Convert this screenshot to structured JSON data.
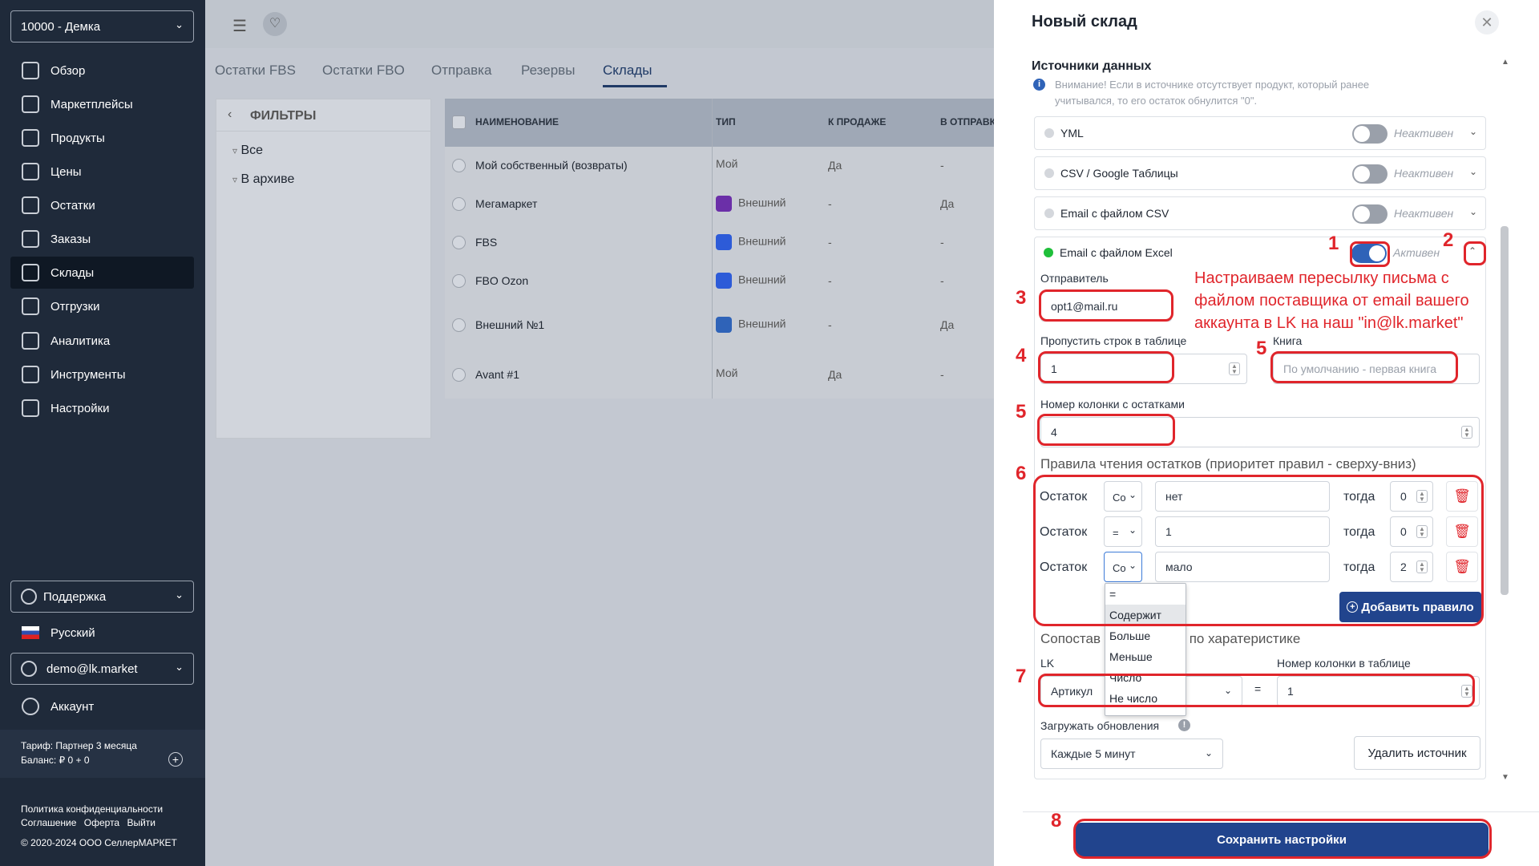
{
  "sidebar": {
    "org": "10000 - Демка",
    "items": [
      {
        "label": "Обзор",
        "icon": "overview-icon"
      },
      {
        "label": "Маркетплейсы",
        "icon": "marketplace-icon"
      },
      {
        "label": "Продукты",
        "icon": "products-icon"
      },
      {
        "label": "Цены",
        "icon": "prices-icon"
      },
      {
        "label": "Остатки",
        "icon": "stock-icon"
      },
      {
        "label": "Заказы",
        "icon": "orders-icon"
      },
      {
        "label": "Склады",
        "icon": "warehouse-icon"
      },
      {
        "label": "Отгрузки",
        "icon": "shipments-icon"
      },
      {
        "label": "Аналитика",
        "icon": "analytics-icon"
      },
      {
        "label": "Инструменты",
        "icon": "tools-icon"
      },
      {
        "label": "Настройки",
        "icon": "settings-icon"
      }
    ],
    "support": "Поддержка",
    "language": "Русский",
    "user": "demo@lk.market",
    "account": "Аккаунт",
    "tariff": "Тариф: Партнер 3 месяца",
    "balance": "Баланс: ₽ 0 + 0",
    "links": [
      "Политика конфиденциальности",
      "Соглашение",
      "Оферта",
      "Выйти"
    ],
    "copyright": "© 2020-2024 ООО СеллерМАРКЕТ"
  },
  "tabs": [
    "Остатки FBS",
    "Остатки FBO",
    "Отправка",
    "Резервы",
    "Склады"
  ],
  "filters": {
    "title": "ФИЛЬТРЫ",
    "items": [
      "Все",
      "В архиве"
    ]
  },
  "table": {
    "headers": [
      "НАИМЕНОВАНИЕ",
      "ТИП",
      "К ПРОДАЖЕ",
      "В ОТПРАВК"
    ],
    "rows": [
      {
        "name": "Мой собственный (возвраты)",
        "type": "Мой",
        "sale": "Да",
        "ship": "-"
      },
      {
        "name": "Мегамаркет",
        "type": "Внешний",
        "sale": "-",
        "ship": "Да"
      },
      {
        "name": "FBS",
        "type": "Внешний",
        "sale": "-",
        "ship": "-"
      },
      {
        "name": "FBO Ozon",
        "type": "Внешний",
        "sale": "-",
        "ship": "-"
      },
      {
        "name": "Внешний №1",
        "type": "Внешний",
        "sale": "-",
        "ship": "Да"
      },
      {
        "name": "Avant #1",
        "type": "Мой",
        "sale": "Да",
        "ship": "-"
      }
    ]
  },
  "modal": {
    "title": "Новый склад",
    "section": "Источники данных",
    "warning": "Внимание! Если в источнике отсутствует продукт, который ранее учитывался, то его остаток обнулится \"0\".",
    "sources": [
      {
        "name": "YML",
        "status": "Неактивен"
      },
      {
        "name": "CSV / Google Таблицы",
        "status": "Неактивен"
      },
      {
        "name": "Email с файлом CSV",
        "status": "Неактивен"
      },
      {
        "name": "Email с файлом Excel",
        "status": "Активен"
      }
    ],
    "sender_label": "Отправитель",
    "sender_value": "opt1@mail.ru",
    "skip_label": "Пропустить строк в таблице",
    "skip_value": "1",
    "book_label": "Книга",
    "book_placeholder": "По умолчанию - первая книга",
    "col_label": "Номер колонки с остатками",
    "col_value": "4",
    "rules_title": "Правила чтения остатков (приоритет правил - сверху-вниз)",
    "rules": [
      {
        "label": "Остаток",
        "op": "Co",
        "value": "нет",
        "then": "тогда",
        "result": "0"
      },
      {
        "label": "Остаток",
        "op": "=",
        "value": "1",
        "then": "тогда",
        "result": "0"
      },
      {
        "label": "Остаток",
        "op": "Co",
        "value": "мало",
        "then": "тогда",
        "result": "2"
      }
    ],
    "dropdown_options": [
      "=",
      "Содержит",
      "Больше",
      "Меньше",
      "Число",
      "Не число"
    ],
    "add_rule": "Добавить правило",
    "match_title_a": "Сопостав",
    "match_title_b": "по харатеристике",
    "lk_label": "LK",
    "lk_value": "Артикул",
    "eq": "=",
    "table_col_label": "Номер колонки в таблице",
    "table_col_value": "1",
    "update_label": "Загружать обновления",
    "update_value": "Каждые 5 минут",
    "delete_source": "Удалить источник",
    "save": "Сохранить настройки"
  },
  "annotation": {
    "note": "Настраиваем пересылку письма с файлом поставщика от email вашего аккаунта в LK на наш \"in@lk.market\"",
    "numbers": [
      "1",
      "2",
      "3",
      "4",
      "5",
      "5",
      "6",
      "7",
      "8"
    ]
  },
  "colors": {
    "sidebar": "#1f2a3a",
    "accent": "#2f63b8",
    "annotation": "#e0252b",
    "save_button": "#21448d"
  }
}
